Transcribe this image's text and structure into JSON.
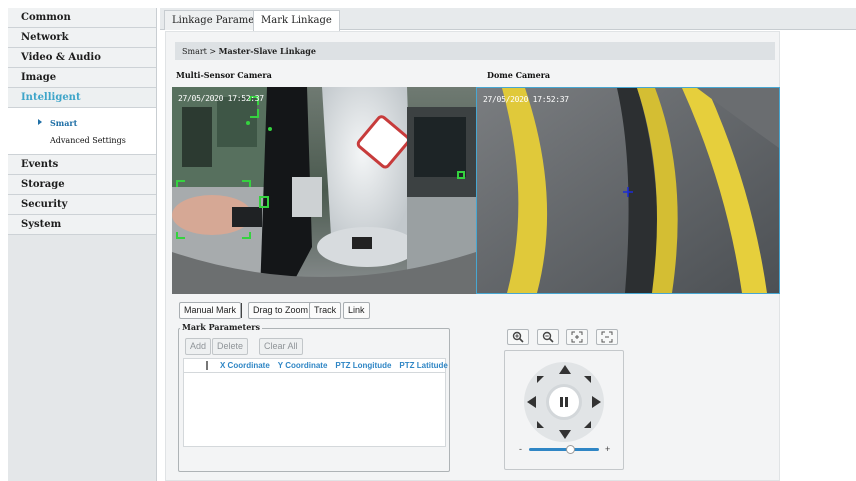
{
  "sidebar": {
    "items": [
      {
        "label": "Common"
      },
      {
        "label": "Network"
      },
      {
        "label": "Video & Audio"
      },
      {
        "label": "Image"
      },
      {
        "label": "Intelligent"
      }
    ],
    "sub_items": [
      {
        "label": "Smart"
      },
      {
        "label": "Advanced Settings"
      }
    ],
    "items_after": [
      {
        "label": "Events"
      },
      {
        "label": "Storage"
      },
      {
        "label": "Security"
      },
      {
        "label": "System"
      }
    ]
  },
  "tabs": [
    {
      "label": "Linkage Parameter"
    },
    {
      "label": "Mark Linkage"
    }
  ],
  "breadcrumb": {
    "parent": "Smart",
    "separator": ">",
    "current": "Master-Slave Linkage"
  },
  "cameras": {
    "multi_sensor": {
      "label": "Multi-Sensor Camera",
      "timestamp": "27/05/2020 17:52:37"
    },
    "dome": {
      "label": "Dome Camera",
      "timestamp": "27/05/2020 17:52:37"
    }
  },
  "toolbar": {
    "manual_mark": "Manual Mark",
    "drag_to_zoom": "Drag to Zoom",
    "track": "Track",
    "link": "Link"
  },
  "mark_parameters": {
    "legend": "Mark Parameters",
    "add": "Add",
    "delete": "Delete",
    "clear_all": "Clear All",
    "columns": [
      "X Coordinate",
      "Y Coordinate",
      "PTZ Longitude",
      "PTZ Latitude"
    ]
  },
  "ptz": {
    "buttons": [
      "zoom-in-icon",
      "zoom-out-icon",
      "focus-near-icon",
      "focus-far-icon"
    ],
    "slider_minus": "-",
    "slider_plus": "+",
    "speed_level": 0.6
  },
  "colors": {
    "accent": "#3ea5c9",
    "header_text": "#2f86c5",
    "crosshair": "#1b2bd8",
    "overlay_box": "#35d23f"
  }
}
